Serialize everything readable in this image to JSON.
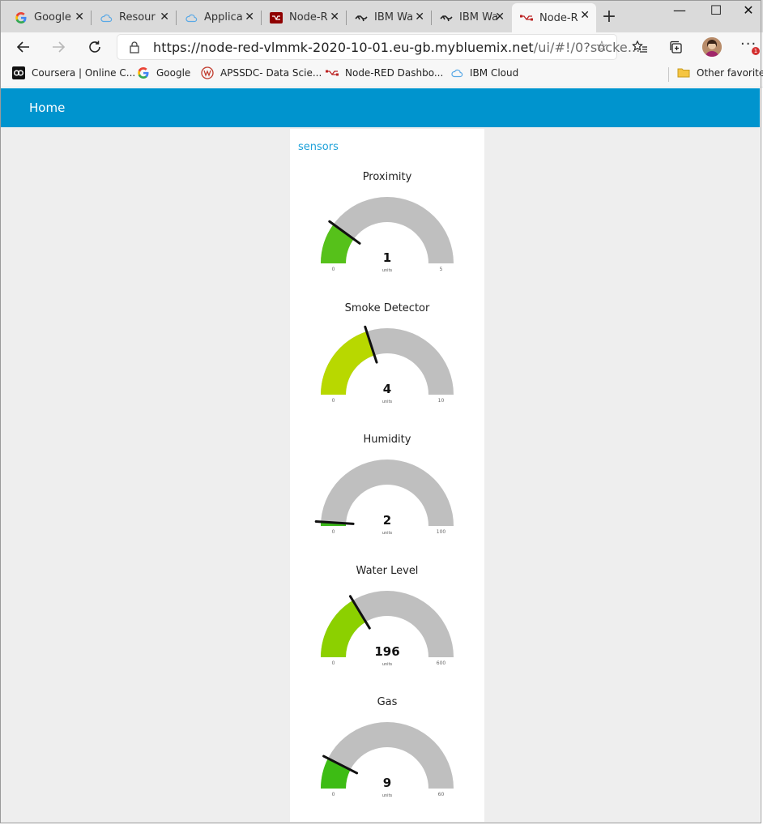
{
  "browser": {
    "tabs": [
      {
        "label": "Google",
        "icon": "google-icon",
        "active": false
      },
      {
        "label": "Resour",
        "icon": "cloud-icon",
        "active": false
      },
      {
        "label": "Applica",
        "icon": "cloud-icon",
        "active": false
      },
      {
        "label": "Node-R",
        "icon": "node-red-icon",
        "active": false
      },
      {
        "label": "IBM Wa",
        "icon": "ibm-watson-icon",
        "active": false
      },
      {
        "label": "IBM Wa",
        "icon": "ibm-watson-icon",
        "active": false
      },
      {
        "label": "Node-R",
        "icon": "node-red-icon",
        "active": true
      }
    ],
    "url_main": "https://node-red-vlmmk-2020-10-01.eu-gb.mybluemix.net",
    "url_rest": "/ui/#!/0?socke...",
    "bookmarks": [
      {
        "label": "Coursera | Online C...",
        "icon": "coursera-icon"
      },
      {
        "label": "Google",
        "icon": "google-icon"
      },
      {
        "label": "APSSDC- Data Scie...",
        "icon": "apssdc-icon"
      },
      {
        "label": "Node-RED Dashbo...",
        "icon": "node-red-icon"
      },
      {
        "label": "IBM Cloud",
        "icon": "cloud-icon"
      }
    ],
    "other_favorites": "Other favorites",
    "notification_count": "1"
  },
  "dashboard": {
    "header_title": "Home",
    "header_color": "#0094ce",
    "group_title": "sensors",
    "gauges": [
      {
        "title": "Proximity",
        "value": 1,
        "display": "1",
        "units": "units",
        "min": 0,
        "max": 5,
        "min_label": "0",
        "max_label": "5",
        "color": "#56c11a"
      },
      {
        "title": "Smoke Detector",
        "value": 4,
        "display": "4",
        "units": "units",
        "min": 0,
        "max": 10,
        "min_label": "0",
        "max_label": "10",
        "color": "#b8d800"
      },
      {
        "title": "Humidity",
        "value": 2,
        "display": "2",
        "units": "units",
        "min": 0,
        "max": 100,
        "min_label": "0",
        "max_label": "100",
        "color": "#3cb81a"
      },
      {
        "title": "Water Level",
        "value": 196,
        "display": "196",
        "units": "units",
        "min": 0,
        "max": 600,
        "min_label": "0",
        "max_label": "600",
        "color": "#8cd000"
      },
      {
        "title": "Gas",
        "value": 9,
        "display": "9",
        "units": "units",
        "min": 0,
        "max": 60,
        "min_label": "0",
        "max_label": "60",
        "color": "#3dbc14"
      }
    ]
  }
}
